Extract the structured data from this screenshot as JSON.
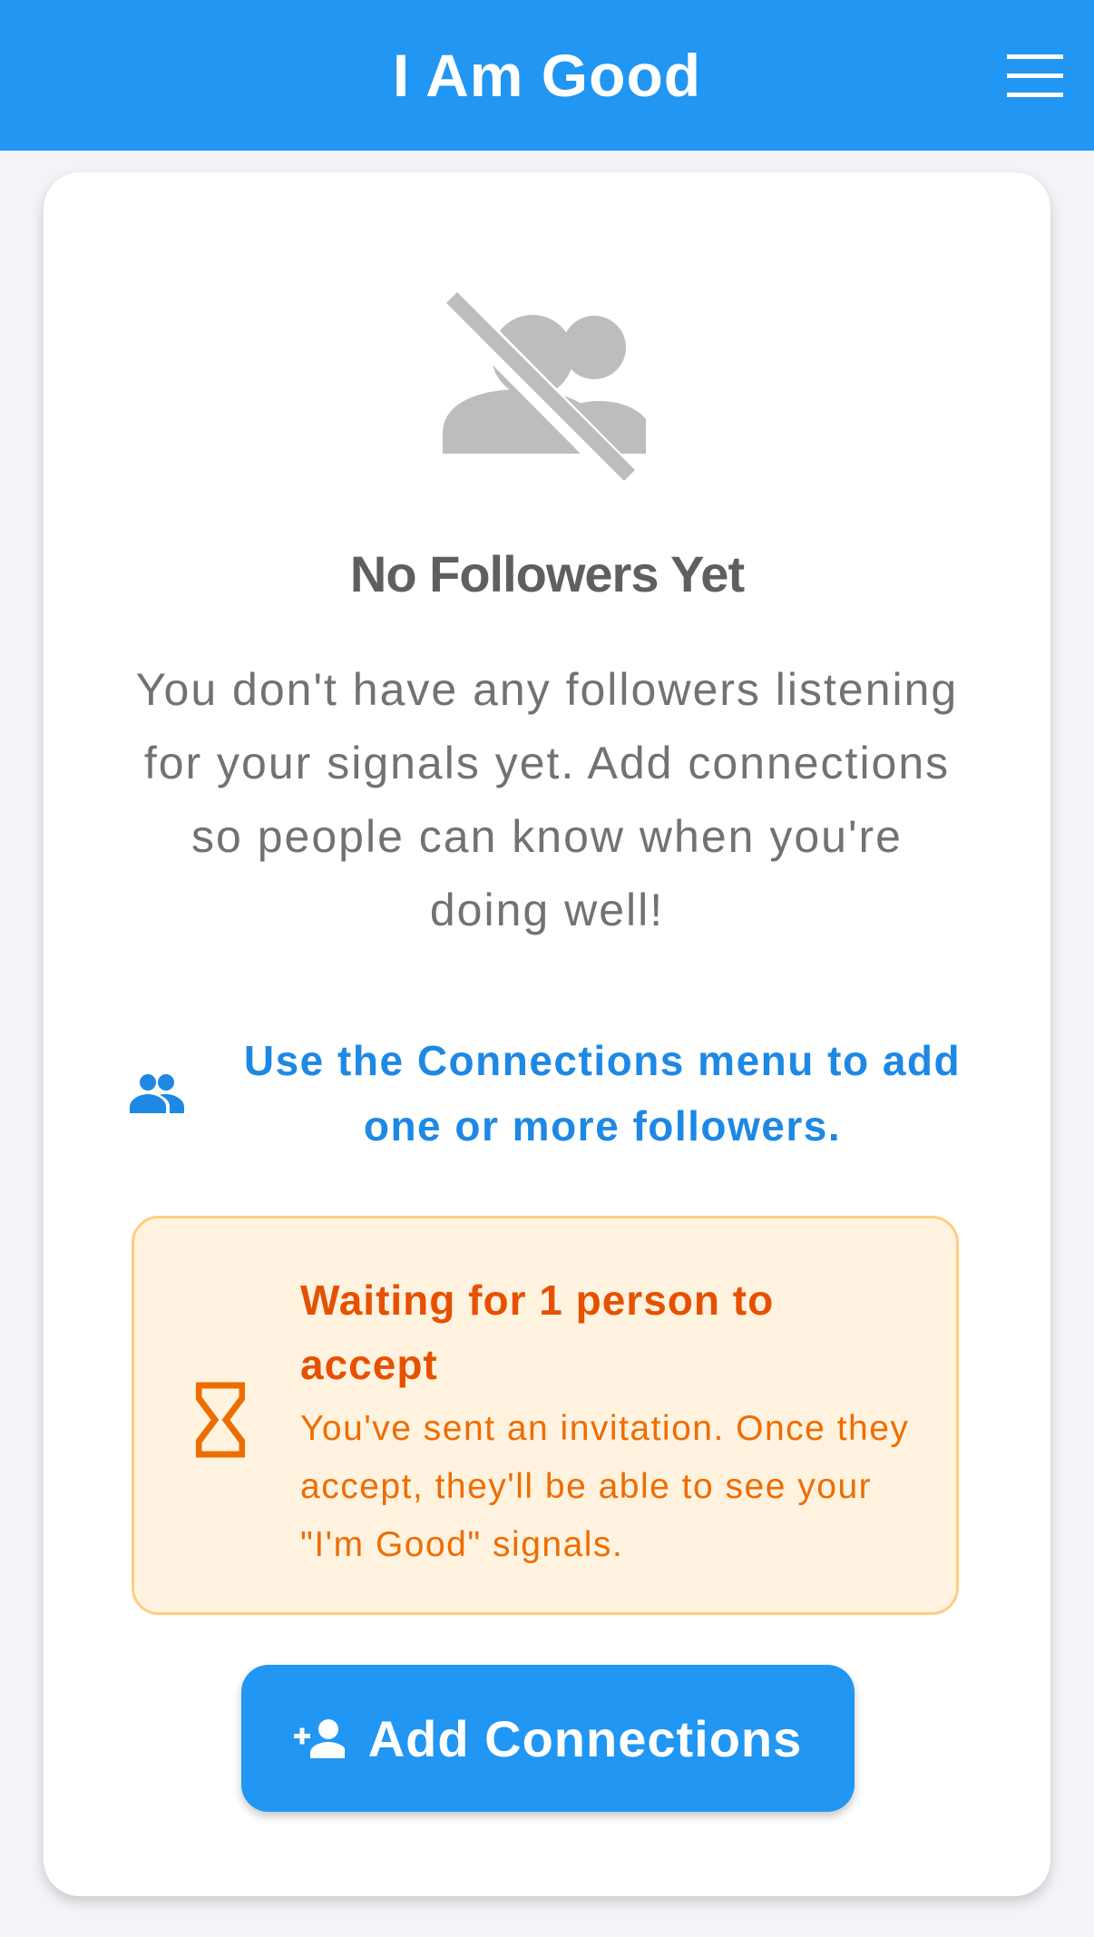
{
  "app_bar": {
    "title": "I Am Good",
    "menu_icon": "hamburger-menu-icon",
    "background_color": "#2196f3"
  },
  "empty_state": {
    "icon": "group-off-icon",
    "title": "No Followers Yet",
    "message": "You don't have any followers listening for your signals yet. Add connections so people can know when you're doing well!"
  },
  "hint": {
    "icon": "people-icon",
    "text": "Use the Connections menu to add one or more followers.",
    "color": "#1e88e5"
  },
  "pending": {
    "icon": "hourglass-icon",
    "title": "Waiting for 1 person to accept",
    "description": "You've sent an invitation. Once they accept, they'll be able to see your \"I'm Good\" signals.",
    "background_color": "#fff3e0",
    "accent_color": "#e65100"
  },
  "add_button": {
    "icon": "person-add-icon",
    "label": "Add Connections",
    "color": "#2196f3"
  }
}
